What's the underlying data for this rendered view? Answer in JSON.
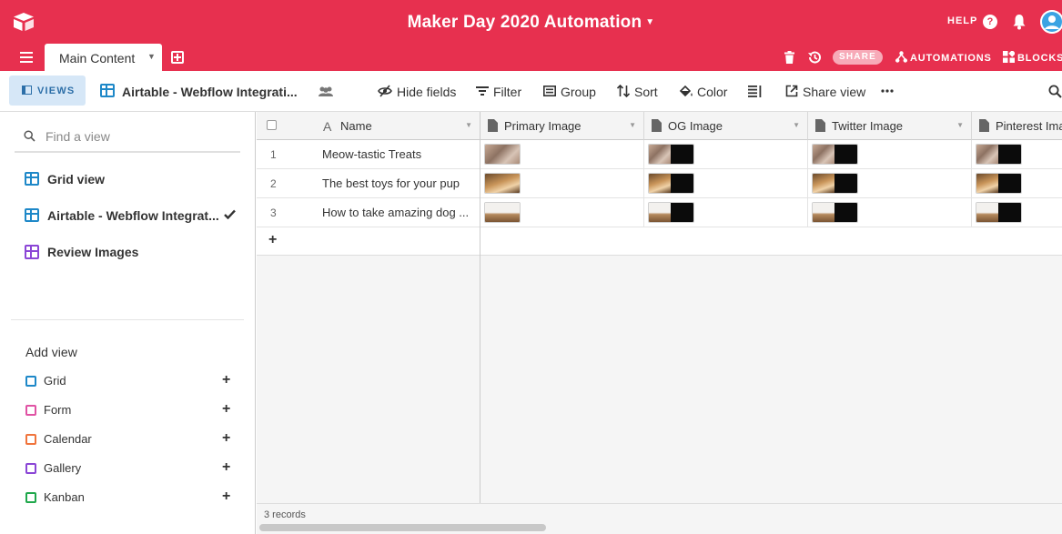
{
  "header": {
    "base_title": "Maker Day 2020 Automation",
    "help_label": "HELP",
    "help_icon_glyph": "?"
  },
  "tabs": {
    "active_table": "Main Content",
    "share_label": "SHARE",
    "automations_label": "AUTOMATIONS",
    "blocks_label": "BLOCKS"
  },
  "viewbar": {
    "views_label": "VIEWS",
    "current_view": "Airtable - Webflow Integrati...",
    "tools": [
      "Hide fields",
      "Filter",
      "Group",
      "Sort",
      "Color",
      "Share view"
    ]
  },
  "sidebar": {
    "search_placeholder": "Find a view",
    "views": [
      {
        "label": "Grid view",
        "icon": "grid-icon"
      },
      {
        "label": "Airtable - Webflow Integrat...",
        "icon": "grid-icon",
        "selected": true
      },
      {
        "label": "Review Images",
        "icon": "gallery-icon"
      }
    ],
    "add_view_title": "Add view",
    "add_view_items": [
      {
        "label": "Grid",
        "color": "#1e88c8"
      },
      {
        "label": "Form",
        "color": "#e052a4"
      },
      {
        "label": "Calendar",
        "color": "#f0743c"
      },
      {
        "label": "Gallery",
        "color": "#8b46d6"
      },
      {
        "label": "Kanban",
        "color": "#20a84c"
      }
    ]
  },
  "grid": {
    "columns": [
      "Name",
      "Primary Image",
      "OG Image",
      "Twitter Image",
      "Pinterest Ima"
    ],
    "rows": [
      {
        "num": "1",
        "name": "Meow-tastic Treats"
      },
      {
        "num": "2",
        "name": "The best toys for your pup"
      },
      {
        "num": "3",
        "name": "How to take amazing dog ..."
      }
    ],
    "record_count": "3 records"
  },
  "colors": {
    "brand": "#e7304f",
    "accent": "#1e88c8"
  }
}
